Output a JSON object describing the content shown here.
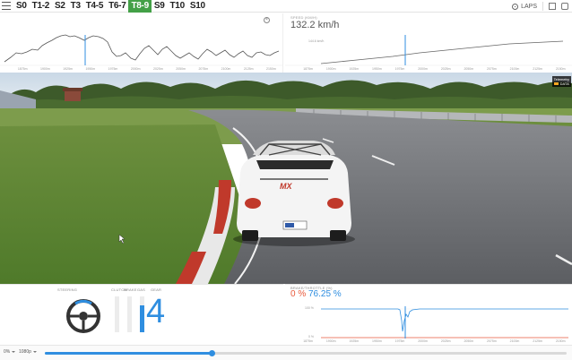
{
  "toolbar": {
    "segments": [
      "S0",
      "T1-2",
      "S2",
      "T3",
      "T4-5",
      "T6-7",
      "T8-9",
      "S9",
      "T10",
      "S10"
    ],
    "active_segment": "T8-9",
    "laps_label": "LAPS"
  },
  "speed_panel": {
    "label": "SPEED (km/h)",
    "value": "132.2 km/h",
    "ref_label": "144.6 km/h"
  },
  "distance_ticks": [
    "1875m",
    "1900m",
    "1925m",
    "1950m",
    "1975m",
    "2000m",
    "2025m",
    "2050m",
    "2075m",
    "2100m",
    "2125m",
    "2150m"
  ],
  "video_overlay": {
    "badge_title": "Telemetry",
    "badge_sub": "DATA"
  },
  "inputs_panel": {
    "steering_label": "STEERING",
    "clutch_label": "CLUTCH",
    "brake_label": "BRAKE",
    "gas_label": "GAS",
    "gear_label": "GEAR",
    "gear_value": "4",
    "clutch_level": 0.0,
    "brake_level": 0.0,
    "gas_level": 0.76
  },
  "pedal_panel": {
    "label": "BRAKE/THROTTLE (%)",
    "brake_value": "0 %",
    "throttle_value": "76.25 %",
    "y_top_label": "100 %",
    "y_bottom_label": "0 %"
  },
  "footer": {
    "speed_option": "0%",
    "quality_option": "1080p",
    "playback_progress": 0.32
  },
  "colors": {
    "accent": "#2f8ee0",
    "active_segment": "#43a047",
    "brake": "#e85a3c"
  }
}
